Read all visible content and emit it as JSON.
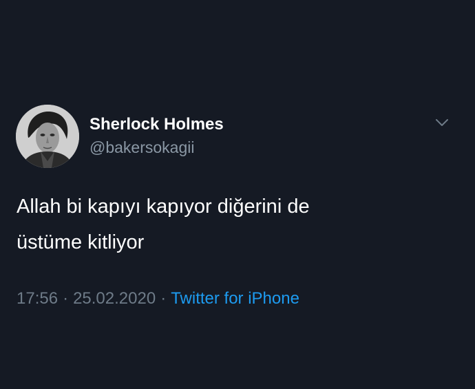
{
  "tweet": {
    "author": {
      "display_name": "Sherlock Holmes",
      "handle": "@bakersokagii",
      "avatar": "sherlock-portrait"
    },
    "text_line_1": "Allah bi kapıyı kapıyor diğerini de",
    "text_line_2": "üstüme kitliyor",
    "time": "17:56",
    "date": "25.02.2020",
    "separator": "·",
    "source": "Twitter for iPhone",
    "menu_icon": "chevron-down-icon"
  },
  "colors": {
    "background": "#151a24",
    "text": "#ffffff",
    "secondary": "#8b98a5",
    "link": "#1d9bf0"
  }
}
